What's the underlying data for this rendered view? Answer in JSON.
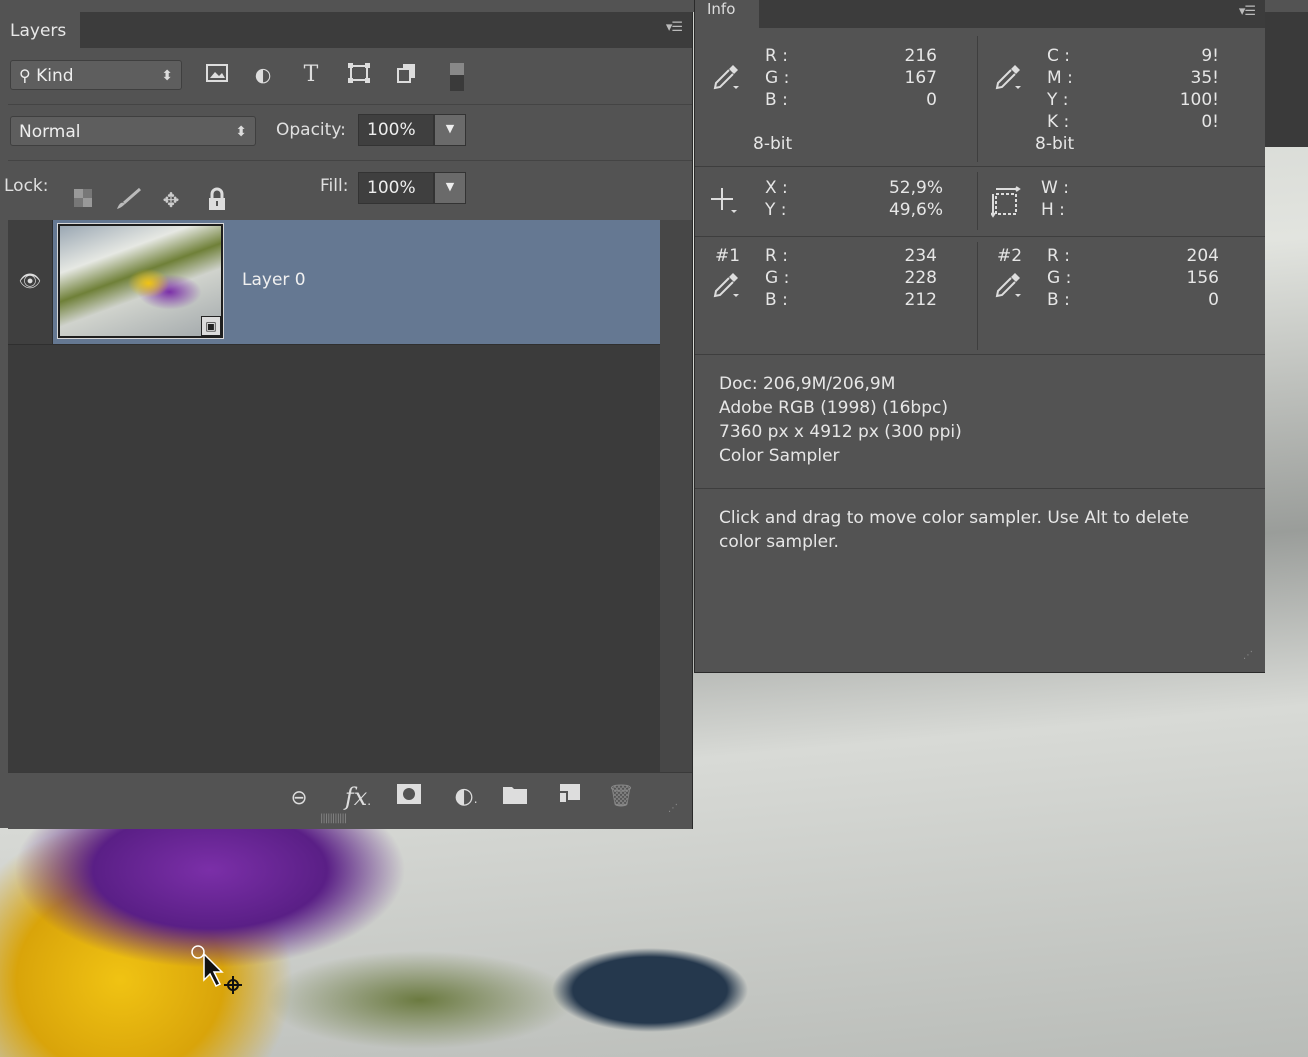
{
  "layers_panel": {
    "tab_label": "Layers",
    "filter": {
      "kind_label": "Kind"
    },
    "blend_mode": "Normal",
    "opacity": {
      "label": "Opacity:",
      "value": "100%"
    },
    "lock_label": "Lock:",
    "fill": {
      "label": "Fill:",
      "value": "100%"
    },
    "layers": [
      {
        "name": "Layer 0",
        "visible": true,
        "selected": true,
        "smart_object": true
      }
    ],
    "footer_icons": [
      "link-layers-icon",
      "fx-icon",
      "layer-mask-icon",
      "adjustment-layer-icon",
      "group-folder-icon",
      "new-layer-icon",
      "trash-icon"
    ],
    "fx_label": "fx"
  },
  "info_panel": {
    "tab_label": "Info",
    "rgb": {
      "r_label": "R :",
      "g_label": "G :",
      "b_label": "B :",
      "r": "216",
      "g": "167",
      "b": "0",
      "bit": "8-bit"
    },
    "cmyk": {
      "c_label": "C :",
      "m_label": "M :",
      "y_label": "Y :",
      "k_label": "K :",
      "c": "9!",
      "m": "35!",
      "y": "100!",
      "k": "0!",
      "bit": "8-bit"
    },
    "position": {
      "x_label": "X :",
      "y_label": "Y :",
      "x": "52,9%",
      "y": "49,6%"
    },
    "size": {
      "w_label": "W :",
      "h_label": "H :"
    },
    "sampler1": {
      "label": "#1",
      "r_label": "R :",
      "g_label": "G :",
      "b_label": "B :",
      "r": "234",
      "g": "228",
      "b": "212"
    },
    "sampler2": {
      "label": "#2",
      "r_label": "R :",
      "g_label": "G :",
      "b_label": "B :",
      "r": "204",
      "g": "156",
      "b": "0"
    },
    "doc_info": {
      "doc_size": "Doc: 206,9M/206,9M",
      "profile": "Adobe RGB (1998) (16bpc)",
      "dimensions": "7360 px x 4912 px (300 ppi)",
      "tool": "Color Sampler"
    },
    "hint_line1": "Click and drag to move color sampler. Use Alt to delete",
    "hint_line2": "color sampler."
  },
  "colors": {
    "panel_bg": "#535353",
    "selected_layer": "#657892",
    "dark_bg": "#3b3b3b"
  }
}
